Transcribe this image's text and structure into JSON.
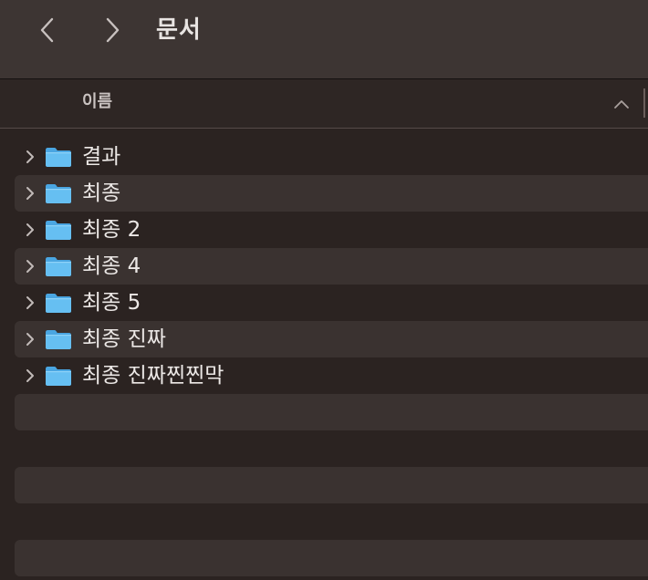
{
  "toolbar": {
    "back_icon": "chevron-left-icon",
    "forward_icon": "chevron-right-icon",
    "title": "문서"
  },
  "columns": {
    "name_label": "이름",
    "sort_icon": "chevron-up-icon"
  },
  "items": [
    {
      "label": "결과",
      "icon": "folder-icon"
    },
    {
      "label": "최종",
      "icon": "folder-icon"
    },
    {
      "label": "최종 2",
      "icon": "folder-icon"
    },
    {
      "label": "최종 4",
      "icon": "folder-icon"
    },
    {
      "label": "최종 5",
      "icon": "folder-icon"
    },
    {
      "label": "최종 진짜",
      "icon": "folder-icon"
    },
    {
      "label": "최종 진짜찐찐막",
      "icon": "folder-icon"
    }
  ],
  "colors": {
    "background": "#2b2321",
    "toolbar": "#3d3533",
    "stripe": "#3a3230",
    "folder": "#5ab4ec",
    "text": "#ece8e6"
  }
}
